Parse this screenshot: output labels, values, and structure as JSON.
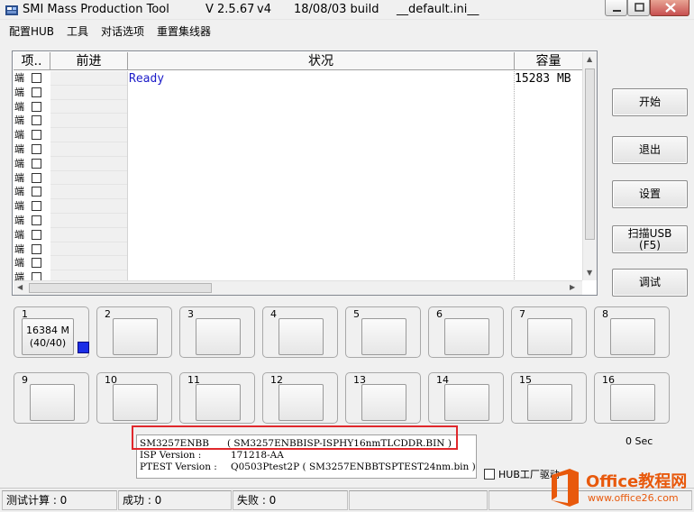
{
  "window": {
    "title": "SMI Mass Production Tool",
    "version": "V 2.5.67",
    "v_tag": "v4",
    "build": "18/08/03 build",
    "ini_file": "__default.ini__"
  },
  "menu": {
    "items": [
      "配置HUB",
      "工具",
      "对话选项",
      "重置集线器"
    ]
  },
  "grid": {
    "columns": [
      "项..",
      "前进",
      "状况",
      "容量"
    ],
    "row_label": "端",
    "row_count": 15,
    "status_text": "Ready",
    "capacity_text": "15283 MB"
  },
  "side_buttons": {
    "start": "开始",
    "exit": "退出",
    "settings": "设置",
    "scan_line1": "扫描USB",
    "scan_line2": "(F5)",
    "debug": "调试"
  },
  "ports": {
    "labels": [
      "1",
      "2",
      "3",
      "4",
      "5",
      "6",
      "7",
      "8",
      "9",
      "10",
      "11",
      "12",
      "13",
      "14",
      "15",
      "16"
    ],
    "port1_capacity": "16384 M",
    "port1_progress": "(40/40)",
    "port1_indicator_color": "#1b2ee6"
  },
  "info": {
    "controller": "SM3257ENBB",
    "isp_file": "( SM3257ENBBISP-ISPHY16nmTLCDDR.BIN )",
    "isp_label": "ISP Version :",
    "isp_value": "171218-AA",
    "ptest_label": "PTEST Version :",
    "ptest_value": "Q0503Ptest2P ( SM3257ENBBTSPTEST24nm.bin )"
  },
  "elapsed": "0 Sec",
  "hub_factory_label": "HUB工厂驱动",
  "status_bar": {
    "test_count": "测试计算 : 0",
    "success": "成功 : 0",
    "fail": "失败 : 0"
  },
  "watermark": {
    "title": "Office教程网",
    "url": "www.office26.com",
    "color": "#e8590c"
  }
}
